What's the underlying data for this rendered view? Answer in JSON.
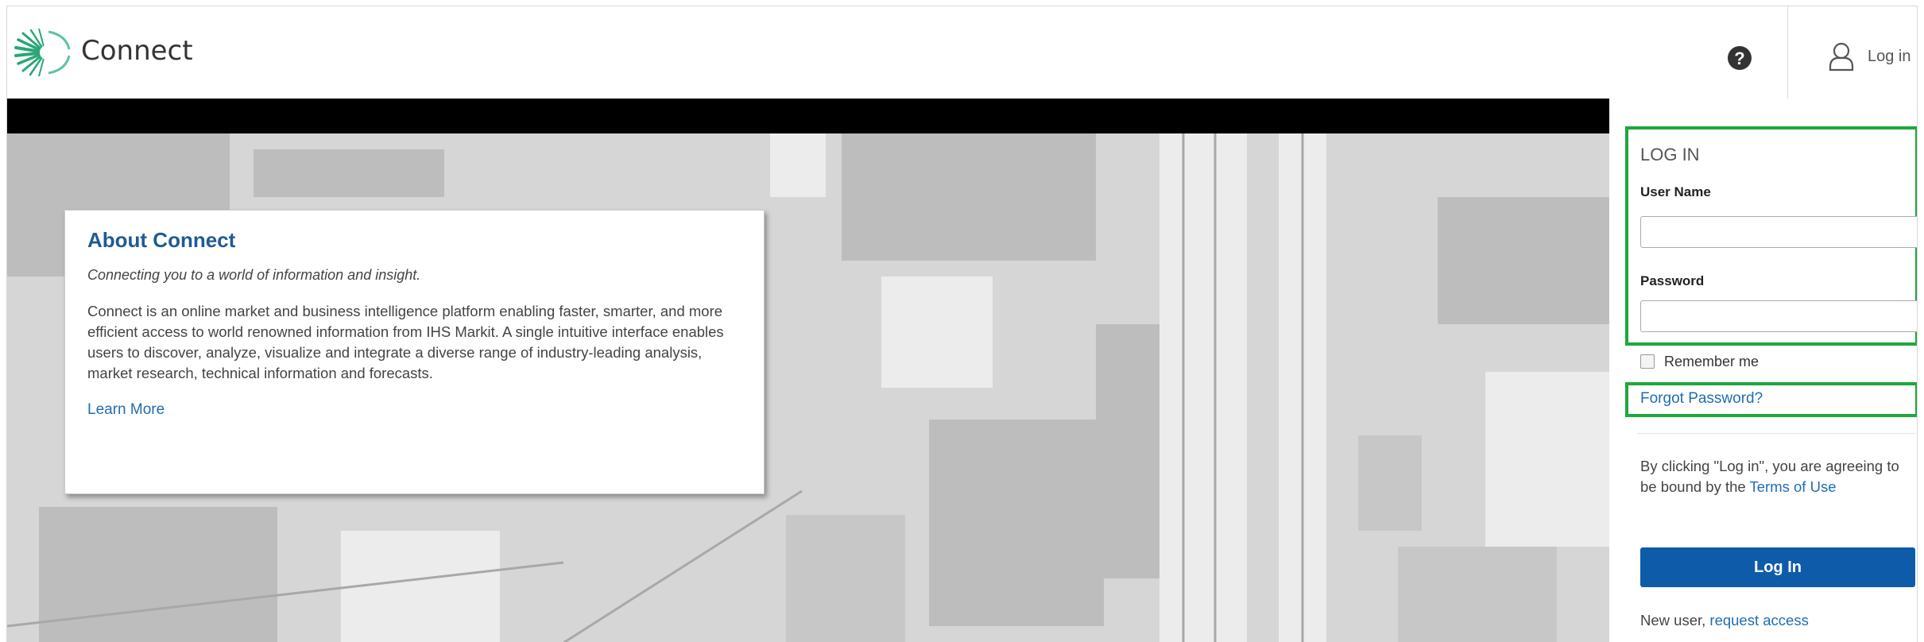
{
  "header": {
    "app_title": "Connect",
    "help_icon": "question-circle-icon",
    "help_symbol": "?",
    "login_label": "Log in"
  },
  "about": {
    "title": "About Connect",
    "tagline": "Connecting you to a world of information and insight.",
    "description": "Connect is an online market and business intelligence platform enabling faster, smarter, and more efficient access to world renowned information from IHS Markit. A single intuitive interface enables users to discover, analyze, visualize and integrate a diverse range of industry-leading analysis, market research, technical information and forecasts.",
    "learn_more": "Learn More"
  },
  "login": {
    "title": "LOG IN",
    "username_label": "User Name",
    "username_value": "",
    "password_label": "Password",
    "password_value": "",
    "remember_label": "Remember me",
    "remember_checked": false,
    "forgot_password": "Forgot Password?",
    "terms_prefix": "By clicking \"Log in\", you are agreeing to be bound by the ",
    "terms_link": "Terms of Use",
    "submit_label": "Log In",
    "new_user_prefix": "New user, ",
    "request_access": "request access"
  },
  "colors": {
    "brand_blue": "#0e5baa",
    "link_blue": "#1f6db5",
    "title_blue": "#1f5b94",
    "highlight_green": "#1ea83b",
    "logo_green": "#2aa776"
  }
}
